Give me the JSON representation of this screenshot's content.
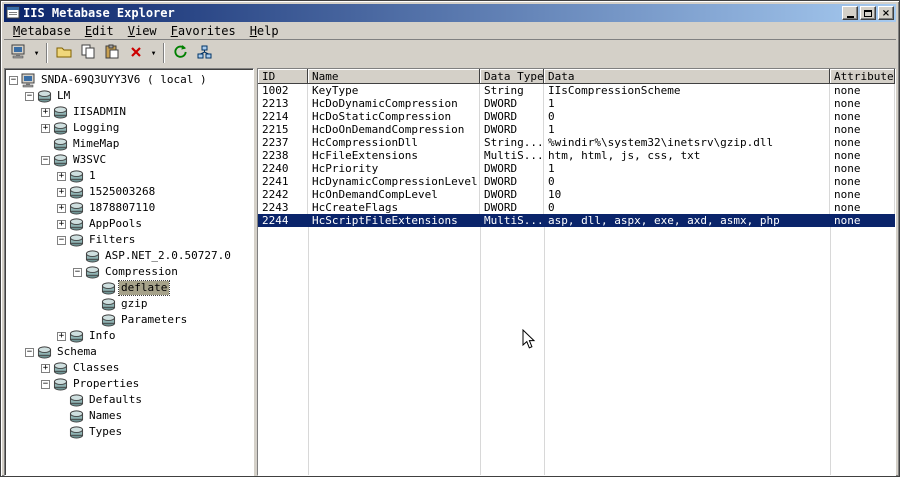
{
  "window": {
    "title": "IIS Metabase Explorer",
    "controls": [
      "minimize",
      "maximize",
      "close"
    ]
  },
  "menu": {
    "items": [
      "Metabase",
      "Edit",
      "View",
      "Favorites",
      "Help"
    ]
  },
  "toolbar": {
    "buttons": [
      {
        "name": "connect",
        "glyph": "computer",
        "dropdown": true,
        "separator_after": true
      },
      {
        "name": "new-key",
        "glyph": "folder"
      },
      {
        "name": "copy",
        "glyph": "copy"
      },
      {
        "name": "paste",
        "glyph": "paste"
      },
      {
        "name": "delete",
        "glyph": "delete",
        "dropdown": true,
        "separator_after": true
      },
      {
        "name": "refresh",
        "glyph": "refresh"
      },
      {
        "name": "permissions",
        "glyph": "network"
      }
    ]
  },
  "tree": {
    "nodes": [
      {
        "label": "SNDA-69Q3UYY3V6 ( local )",
        "level": 0,
        "expand": "minus",
        "icon": "computer"
      },
      {
        "label": "LM",
        "level": 1,
        "expand": "minus",
        "icon": "key"
      },
      {
        "label": "IISADMIN",
        "level": 2,
        "expand": "plus",
        "icon": "key"
      },
      {
        "label": "Logging",
        "level": 2,
        "expand": "plus",
        "icon": "key"
      },
      {
        "label": "MimeMap",
        "level": 2,
        "expand": "none",
        "icon": "key"
      },
      {
        "label": "W3SVC",
        "level": 2,
        "expand": "minus",
        "icon": "key"
      },
      {
        "label": "1",
        "level": 3,
        "expand": "plus",
        "icon": "key"
      },
      {
        "label": "1525003268",
        "level": 3,
        "expand": "plus",
        "icon": "key"
      },
      {
        "label": "1878807110",
        "level": 3,
        "expand": "plus",
        "icon": "key"
      },
      {
        "label": "AppPools",
        "level": 3,
        "expand": "plus",
        "icon": "key"
      },
      {
        "label": "Filters",
        "level": 3,
        "expand": "minus",
        "icon": "key"
      },
      {
        "label": "ASP.NET_2.0.50727.0",
        "level": 4,
        "expand": "none",
        "icon": "key"
      },
      {
        "label": "Compression",
        "level": 4,
        "expand": "minus",
        "icon": "key"
      },
      {
        "label": "deflate",
        "level": 5,
        "expand": "none",
        "icon": "key",
        "selected": true
      },
      {
        "label": "gzip",
        "level": 5,
        "expand": "none",
        "icon": "key"
      },
      {
        "label": "Parameters",
        "level": 5,
        "expand": "none",
        "icon": "key"
      },
      {
        "label": "Info",
        "level": 3,
        "expand": "plus",
        "icon": "key"
      },
      {
        "label": "Schema",
        "level": 1,
        "expand": "minus",
        "icon": "key"
      },
      {
        "label": "Classes",
        "level": 2,
        "expand": "plus",
        "icon": "key"
      },
      {
        "label": "Properties",
        "level": 2,
        "expand": "minus",
        "icon": "key"
      },
      {
        "label": "Defaults",
        "level": 3,
        "expand": "none",
        "icon": "key"
      },
      {
        "label": "Names",
        "level": 3,
        "expand": "none",
        "icon": "key"
      },
      {
        "label": "Types",
        "level": 3,
        "expand": "none",
        "icon": "key"
      }
    ]
  },
  "table": {
    "columns": [
      "ID",
      "Name",
      "Data Type",
      "Data",
      "Attributes"
    ],
    "selected_row_index": 10,
    "rows": [
      [
        "1002",
        "KeyType",
        "String",
        "IIsCompressionScheme",
        "none"
      ],
      [
        "2213",
        "HcDoDynamicCompression",
        "DWORD",
        "1",
        "none"
      ],
      [
        "2214",
        "HcDoStaticCompression",
        "DWORD",
        "0",
        "none"
      ],
      [
        "2215",
        "HcDoOnDemandCompression",
        "DWORD",
        "1",
        "none"
      ],
      [
        "2237",
        "HcCompressionDll",
        "String...",
        "%windir%\\system32\\inetsrv\\gzip.dll",
        "none"
      ],
      [
        "2238",
        "HcFileExtensions",
        "MultiS...",
        "htm, html, js, css, txt",
        "none"
      ],
      [
        "2240",
        "HcPriority",
        "DWORD",
        "1",
        "none"
      ],
      [
        "2241",
        "HcDynamicCompressionLevel",
        "DWORD",
        "0",
        "none"
      ],
      [
        "2242",
        "HcOnDemandCompLevel",
        "DWORD",
        "10",
        "none"
      ],
      [
        "2243",
        "HcCreateFlags",
        "DWORD",
        "0",
        "none"
      ],
      [
        "2244",
        "HcScriptFileExtensions",
        "MultiS...",
        "asp, dll, aspx, exe, axd, asmx, php",
        "none"
      ]
    ]
  },
  "colors": {
    "titlebar_start": "#0a246a",
    "titlebar_end": "#a6caf0",
    "selection": "#0a246a",
    "inactive_selection": "#a6a28a",
    "chrome": "#d4d0c8"
  }
}
